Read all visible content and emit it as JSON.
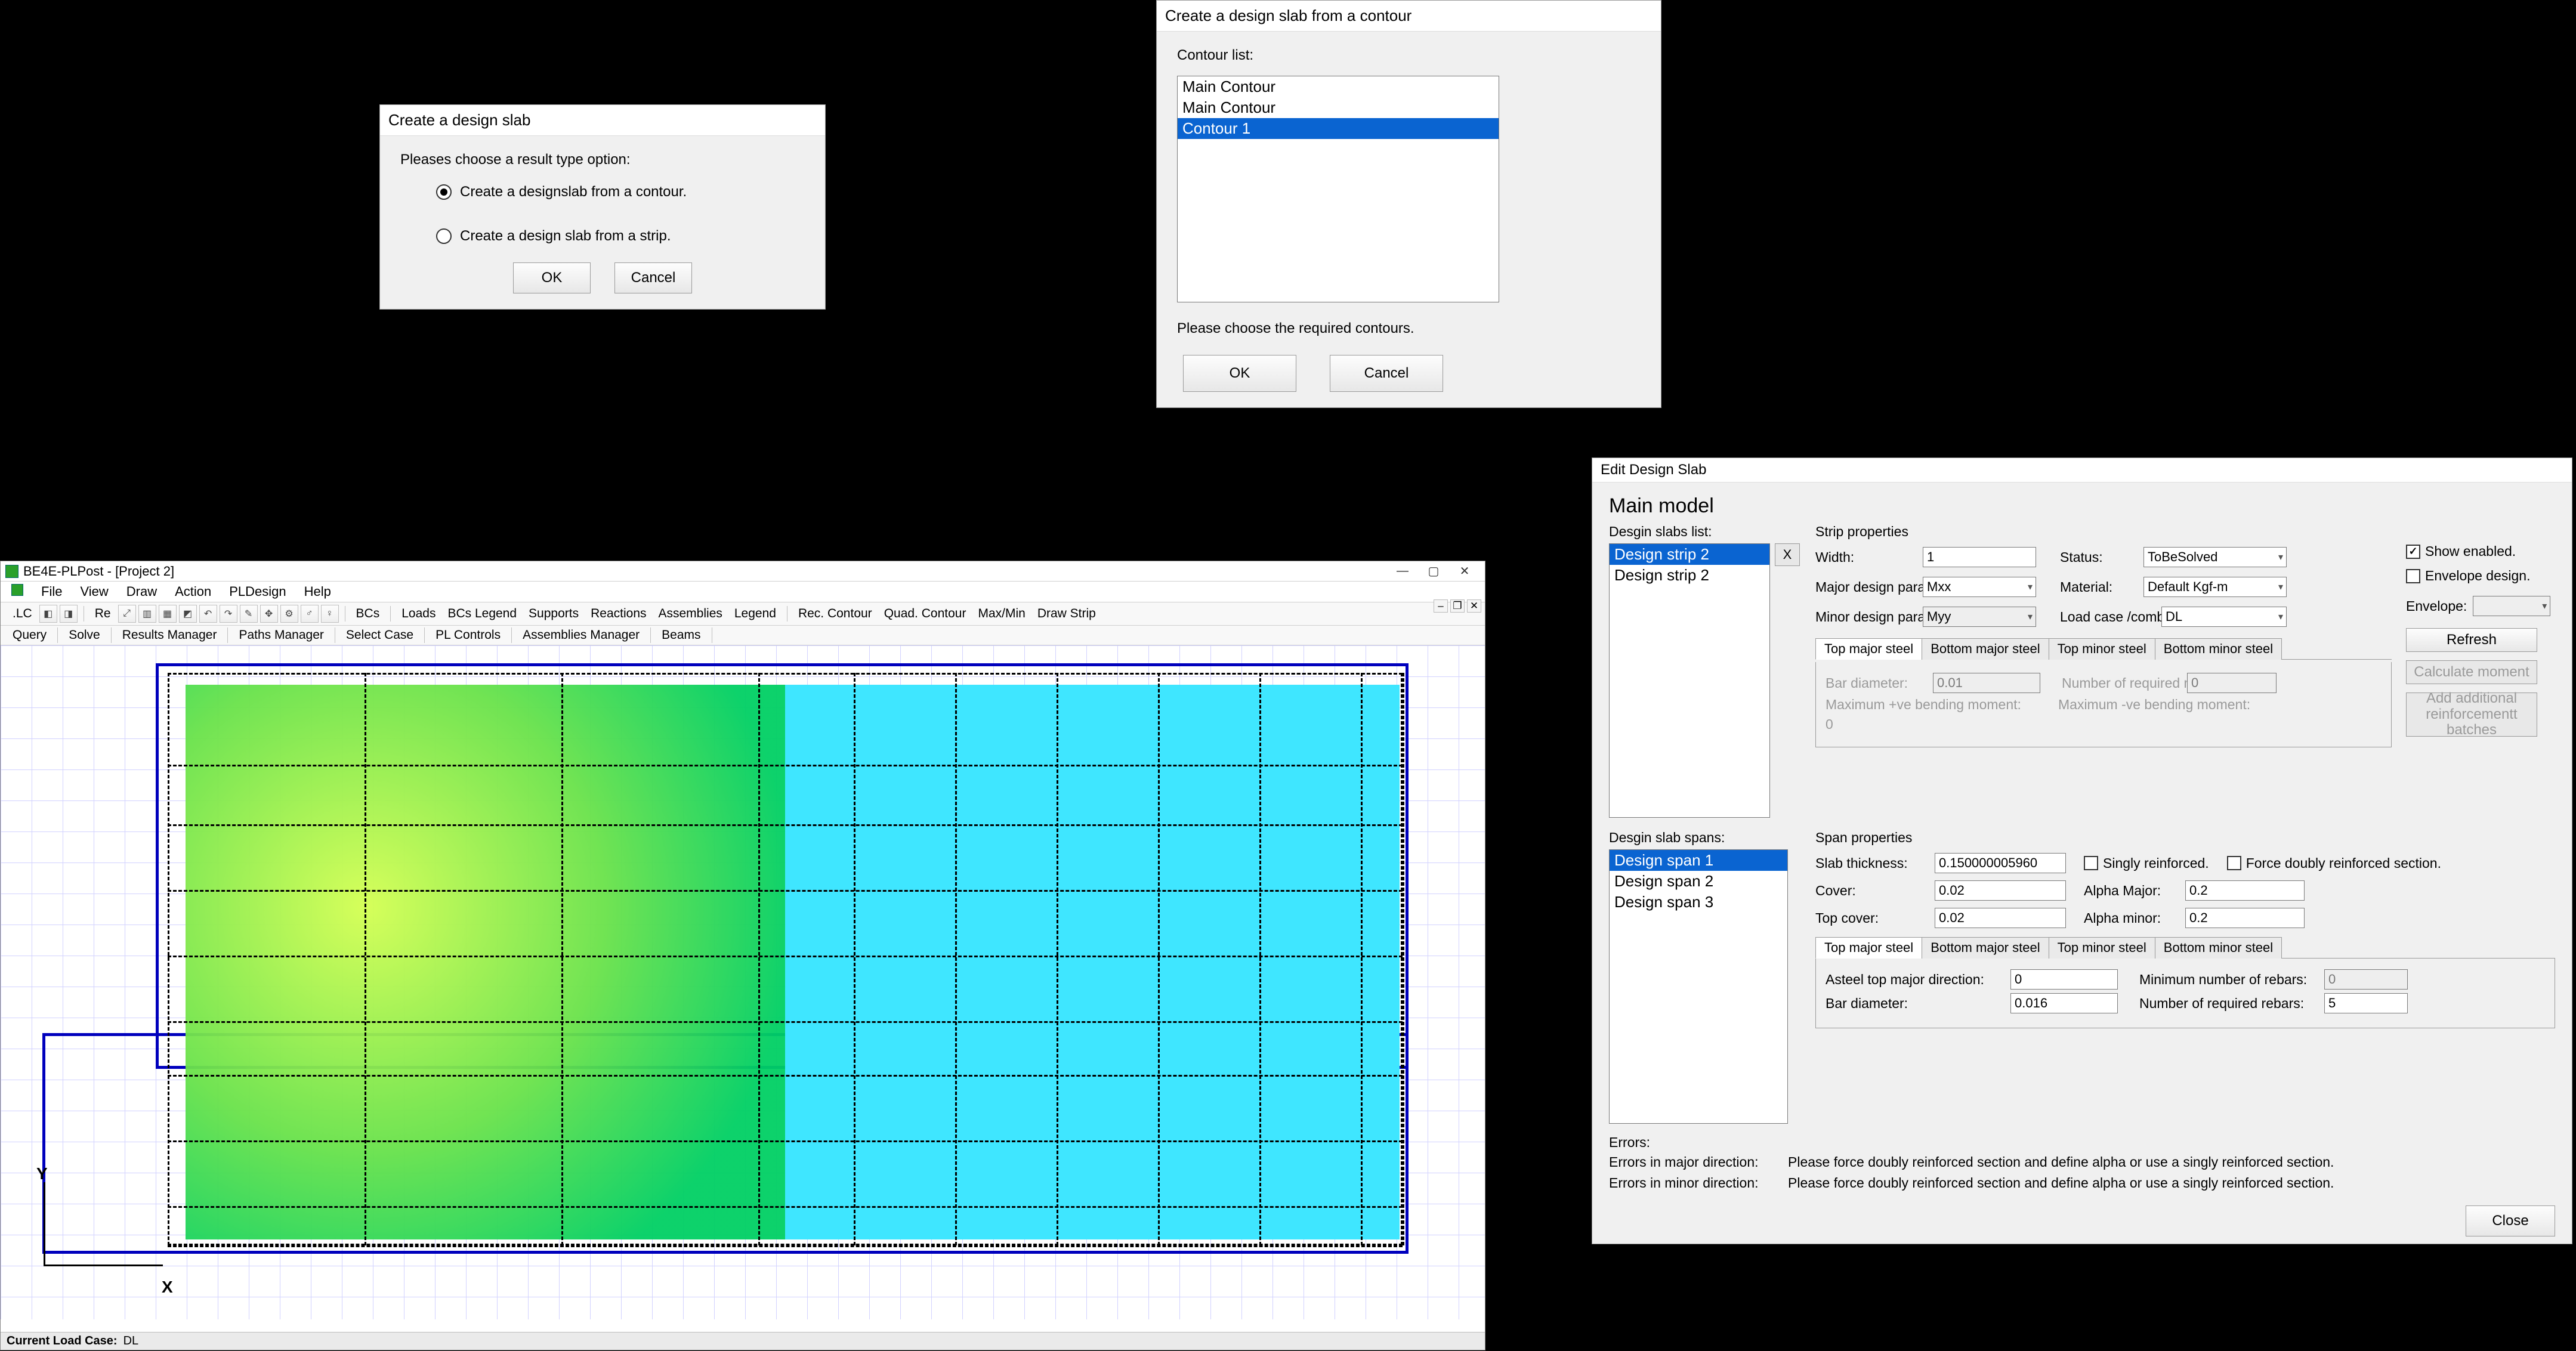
{
  "dialog1": {
    "title": "Create a design slab",
    "prompt": "Pleases choose a result type option:",
    "opt1": "Create a designslab from a contour.",
    "opt2": "Create a design slab from a strip.",
    "ok": "OK",
    "cancel": "Cancel"
  },
  "dialog2": {
    "title": "Create a design slab from a contour",
    "list_label": "Contour list:",
    "items": [
      "Main Contour",
      "Main Contour",
      "Contour 1"
    ],
    "selected_index": 2,
    "footer": "Please choose the required contours.",
    "ok": "OK",
    "cancel": "Cancel"
  },
  "app": {
    "title": "BE4E-PLPost - [Project 2]",
    "menus": [
      "File",
      "View",
      "Draw",
      "Action",
      "PLDesign",
      "Help"
    ],
    "toolbar_text_left": ".LC",
    "toolbar_re": "Re",
    "toolbar_bcs": "BCs",
    "toolbar_text_items": [
      "Loads",
      "BCs Legend",
      "Supports",
      "Reactions",
      "Assemblies",
      "Legend"
    ],
    "toolbar_text_items2": [
      "Rec. Contour",
      "Quad. Contour",
      "Max/Min",
      "Draw Strip"
    ],
    "subbar_items": [
      "Query",
      "Solve",
      "Results Manager",
      "Paths Manager",
      "Select Case",
      "PL Controls",
      "Assemblies Manager",
      "Beams"
    ],
    "status_label": "Current Load Case:",
    "status_value": "DL",
    "axis_x": "X",
    "axis_y": "Y"
  },
  "eds": {
    "title": "Edit Design Slab",
    "heading": "Main model",
    "slabs_list_label": "Desgin slabs list:",
    "slabs": [
      "Design strip 2",
      "Design strip 2"
    ],
    "slabs_sel": 0,
    "x_button": "X",
    "strip_props_label": "Strip properties",
    "width_label": "Width:",
    "width_val": "1",
    "status_label": "Status:",
    "status_val": "ToBeSolved",
    "show_enabled": "Show enabled.",
    "major_label": "Major design parameter:",
    "major_val": "Mxx",
    "material_label": "Material:",
    "material_val": "Default Kgf-m",
    "envelope_chk": "Envelope design.",
    "minor_label": "Minor design parameter:",
    "minor_val": "Myy",
    "loadcase_label": "Load case /combination:",
    "loadcase_val": "DL",
    "envelope_label": "Envelope:",
    "tabs": [
      "Top major steel",
      "Bottom major steel",
      "Top minor steel",
      "Bottom minor steel"
    ],
    "tabs_active": 0,
    "bar_dia_label": "Bar diameter:",
    "bar_dia_val": "0.01",
    "num_rebar_label": "Number of required rebars:",
    "num_rebar_val": "0",
    "max_pos_label": "Maximum +ve bending moment:",
    "max_pos_val": "0",
    "max_neg_label": "Maximum -ve bending moment:",
    "max_neg_val": "",
    "refresh": "Refresh",
    "calc_moment": "Calculate moment",
    "add_batches": "Add additional reinforcementt batches",
    "spans_label": "Desgin slab spans:",
    "spans": [
      "Design span 1",
      "Design span 2",
      "Design span 3"
    ],
    "spans_sel": 0,
    "span_props_label": "Span properties",
    "slab_th_label": "Slab thickness:",
    "slab_th_val": "0.150000005960",
    "singly": "Singly reinforced.",
    "force_dbl": "Force doubly reinforced section.",
    "cover_label": "Cover:",
    "cover_val": "0.02",
    "alpha_major_label": "Alpha Major:",
    "alpha_major_val": "0.2",
    "topcover_label": "Top cover:",
    "topcover_val": "0.02",
    "alpha_minor_label": "Alpha minor:",
    "alpha_minor_val": "0.2",
    "tabs2": [
      "Top major steel",
      "Bottom major steel",
      "Top minor steel",
      "Bottom minor steel"
    ],
    "tabs2_active": 0,
    "asteel_label": "Asteel top major direction:",
    "asteel_val": "0",
    "min_reb_label": "Minimum number of rebars:",
    "min_reb_val": "0",
    "bar_dia2_label": "Bar diameter:",
    "bar_dia2_val": "0.016",
    "num_req_label": "Number of required rebars:",
    "num_req_val": "5",
    "errors_label": "Errors:",
    "err_major_label": "Errors in major direction:",
    "err_major_text": "Please force doubly reinforced section and define alpha or use a singly reinforced section.",
    "err_minor_label": "Errors in minor direction:",
    "err_minor_text": "Please force doubly reinforced section and define alpha or use a singly reinforced section.",
    "close": "Close"
  }
}
